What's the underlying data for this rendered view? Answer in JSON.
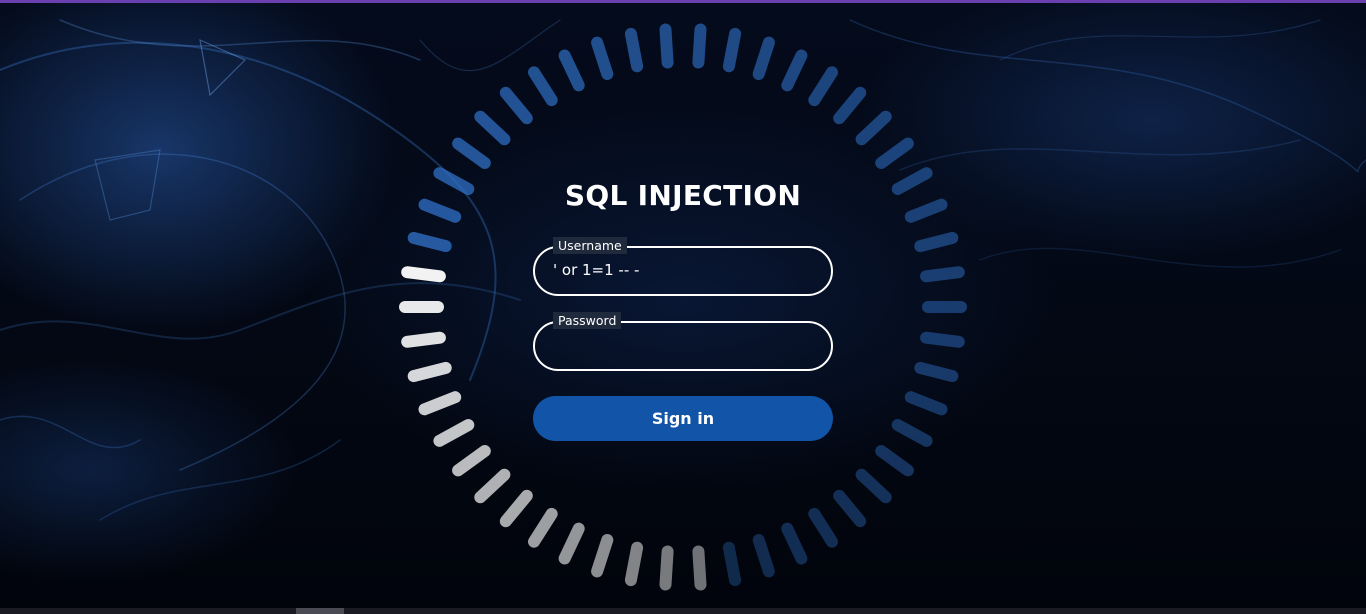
{
  "login": {
    "title": "SQL INJECTION",
    "username": {
      "label": "Username",
      "value": "' or 1=1 -- -"
    },
    "password": {
      "label": "Password",
      "value": ""
    },
    "submit_label": "Sign in"
  },
  "colors": {
    "accent_blue": "#1255a8",
    "ring_active": "#ffffff",
    "top_bar": "#6a3fb0"
  },
  "ring": {
    "segments": 50,
    "progress": 0.3
  }
}
